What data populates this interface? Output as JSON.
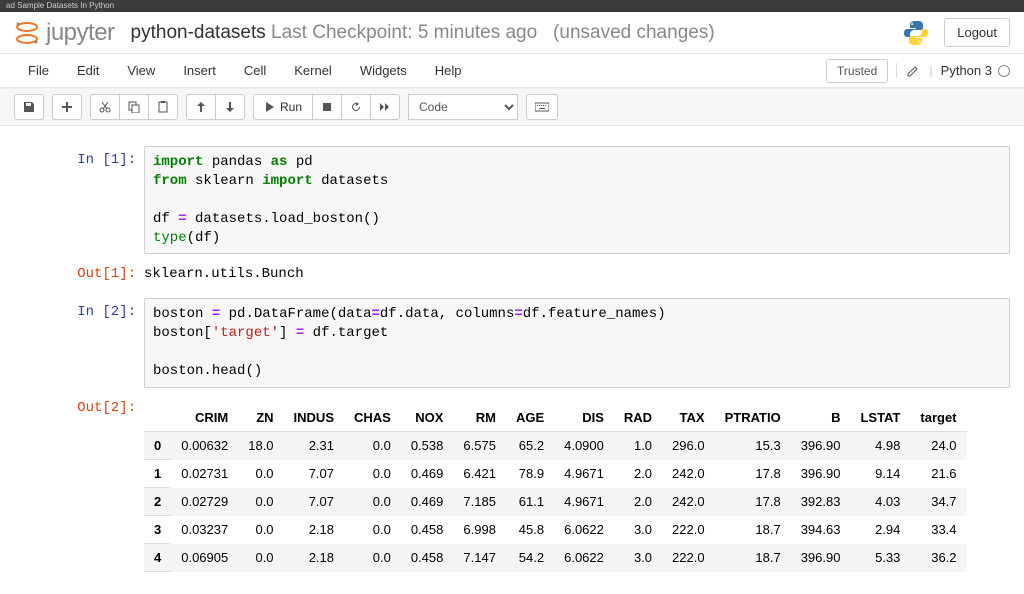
{
  "tab_label": "ad Sample Datasets In Python",
  "header": {
    "logo_text": "jupyter",
    "notebook_name": "python-datasets",
    "checkpoint": "Last Checkpoint: 5 minutes ago",
    "unsaved": "(unsaved changes)",
    "logout": "Logout"
  },
  "menu": {
    "items": [
      "File",
      "Edit",
      "View",
      "Insert",
      "Cell",
      "Kernel",
      "Widgets",
      "Help"
    ],
    "trusted": "Trusted",
    "kernel": "Python 3"
  },
  "toolbar": {
    "run_label": "Run",
    "celltype": "Code"
  },
  "cells": [
    {
      "in_prompt": "In [1]:",
      "code_html": "<span class='kw-green'>import</span> <span class='nm'>pandas</span> <span class='kw-green'>as</span> <span class='nm'>pd</span>\n<span class='kw-green'>from</span> <span class='nm'>sklearn</span> <span class='kw-green'>import</span> <span class='nm'>datasets</span>\n\n<span class='nm'>df</span> <span class='op'>=</span> <span class='nm'>datasets</span>.<span class='fn'>load_boston</span>()\n<span class='builtin'>type</span>(<span class='nm'>df</span>)",
      "out_prompt": "Out[1]:",
      "output_text": "sklearn.utils.Bunch"
    },
    {
      "in_prompt": "In [2]:",
      "code_html": "<span class='nm'>boston</span> <span class='op'>=</span> <span class='nm'>pd</span>.<span class='fn'>DataFrame</span>(<span class='nm'>data</span><span class='op'>=</span><span class='nm'>df</span>.<span class='nm'>data</span>, <span class='nm'>columns</span><span class='op'>=</span><span class='nm'>df</span>.<span class='nm'>feature_names</span>)\n<span class='nm'>boston</span>[<span class='str'>'target'</span>] <span class='op'>=</span> <span class='nm'>df</span>.<span class='nm'>target</span>\n\n<span class='nm'>boston</span>.<span class='fn'>head</span>()",
      "out_prompt": "Out[2]:"
    }
  ],
  "dataframe": {
    "columns": [
      "CRIM",
      "ZN",
      "INDUS",
      "CHAS",
      "NOX",
      "RM",
      "AGE",
      "DIS",
      "RAD",
      "TAX",
      "PTRATIO",
      "B",
      "LSTAT",
      "target"
    ],
    "index": [
      "0",
      "1",
      "2",
      "3",
      "4"
    ],
    "rows": [
      [
        "0.00632",
        "18.0",
        "2.31",
        "0.0",
        "0.538",
        "6.575",
        "65.2",
        "4.0900",
        "1.0",
        "296.0",
        "15.3",
        "396.90",
        "4.98",
        "24.0"
      ],
      [
        "0.02731",
        "0.0",
        "7.07",
        "0.0",
        "0.469",
        "6.421",
        "78.9",
        "4.9671",
        "2.0",
        "242.0",
        "17.8",
        "396.90",
        "9.14",
        "21.6"
      ],
      [
        "0.02729",
        "0.0",
        "7.07",
        "0.0",
        "0.469",
        "7.185",
        "61.1",
        "4.9671",
        "2.0",
        "242.0",
        "17.8",
        "392.83",
        "4.03",
        "34.7"
      ],
      [
        "0.03237",
        "0.0",
        "2.18",
        "0.0",
        "0.458",
        "6.998",
        "45.8",
        "6.0622",
        "3.0",
        "222.0",
        "18.7",
        "394.63",
        "2.94",
        "33.4"
      ],
      [
        "0.06905",
        "0.0",
        "2.18",
        "0.0",
        "0.458",
        "7.147",
        "54.2",
        "6.0622",
        "3.0",
        "222.0",
        "18.7",
        "396.90",
        "5.33",
        "36.2"
      ]
    ]
  }
}
